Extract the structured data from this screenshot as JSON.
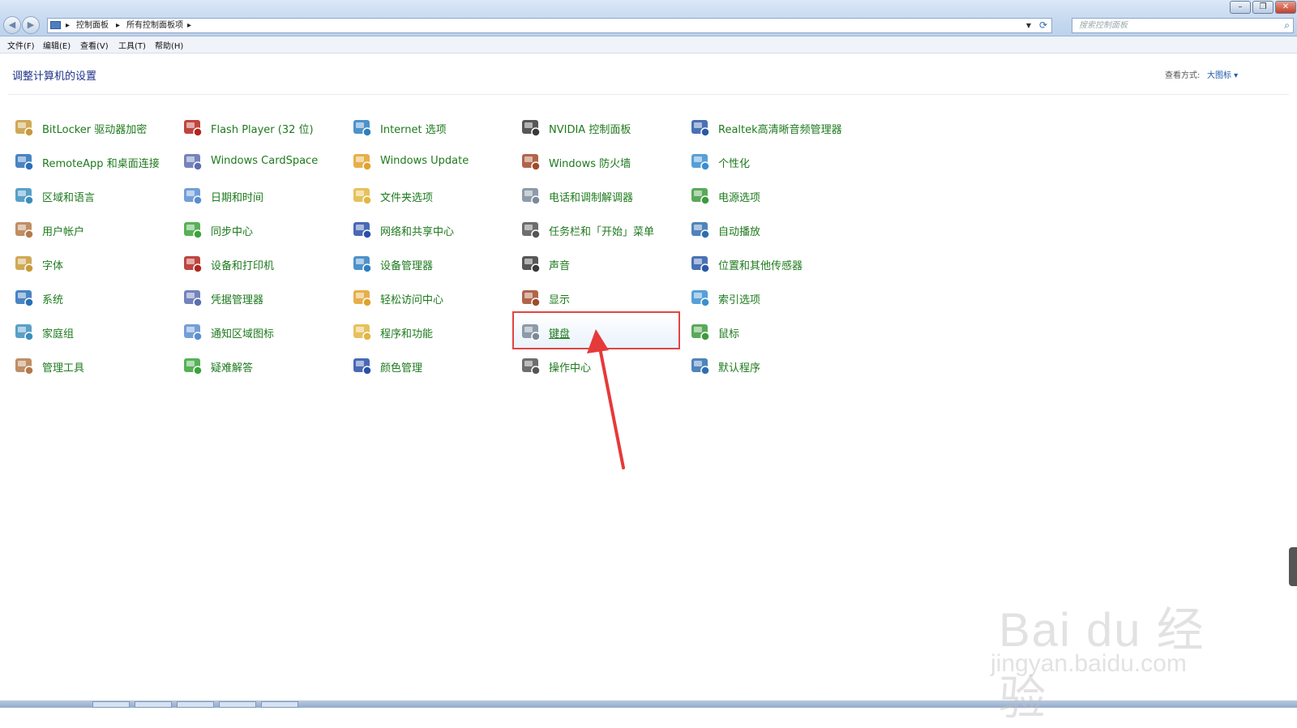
{
  "window": {
    "nav_back": "◀",
    "nav_forward": "▶",
    "breadcrumb": [
      "控制面板",
      "所有控制面板项"
    ],
    "crumb_separator": "▸",
    "search_placeholder": "搜索控制面板",
    "search_icon": "magnifier-icon",
    "refresh_icon": "refresh-icon",
    "controls": {
      "minimize": "–",
      "restore": "❐",
      "close": "✕"
    }
  },
  "menubar": [
    "文件(F)",
    "编辑(E)",
    "查看(V)",
    "工具(T)",
    "帮助(H)"
  ],
  "header": {
    "title": "调整计算机的设置",
    "view_by_label": "查看方式:",
    "view_by_value": "大图标 ▾"
  },
  "items": [
    {
      "label": "BitLocker 驱动器加密",
      "icon": "bitlocker-icon"
    },
    {
      "label": "Flash Player (32 位)",
      "icon": "flash-player-icon"
    },
    {
      "label": "Internet 选项",
      "icon": "internet-options-icon"
    },
    {
      "label": "NVIDIA 控制面板",
      "icon": "nvidia-icon"
    },
    {
      "label": "Realtek高清晰音频管理器",
      "icon": "realtek-audio-icon"
    },
    {
      "label": "RemoteApp 和桌面连接",
      "icon": "remoteapp-icon"
    },
    {
      "label": "Windows CardSpace",
      "icon": "cardspace-icon"
    },
    {
      "label": "Windows Update",
      "icon": "windows-update-icon"
    },
    {
      "label": "Windows 防火墙",
      "icon": "firewall-icon"
    },
    {
      "label": "个性化",
      "icon": "personalization-icon"
    },
    {
      "label": "区域和语言",
      "icon": "region-language-icon"
    },
    {
      "label": "日期和时间",
      "icon": "date-time-icon"
    },
    {
      "label": "文件夹选项",
      "icon": "folder-options-icon"
    },
    {
      "label": "电话和调制解调器",
      "icon": "phone-modem-icon"
    },
    {
      "label": "电源选项",
      "icon": "power-options-icon"
    },
    {
      "label": "用户帐户",
      "icon": "user-accounts-icon"
    },
    {
      "label": "同步中心",
      "icon": "sync-center-icon"
    },
    {
      "label": "网络和共享中心",
      "icon": "network-sharing-icon"
    },
    {
      "label": "任务栏和「开始」菜单",
      "icon": "taskbar-start-icon"
    },
    {
      "label": "自动播放",
      "icon": "autoplay-icon"
    },
    {
      "label": "字体",
      "icon": "fonts-icon"
    },
    {
      "label": "设备和打印机",
      "icon": "devices-printers-icon"
    },
    {
      "label": "设备管理器",
      "icon": "device-manager-icon"
    },
    {
      "label": "声音",
      "icon": "sound-icon"
    },
    {
      "label": "位置和其他传感器",
      "icon": "location-sensors-icon"
    },
    {
      "label": "系统",
      "icon": "system-icon"
    },
    {
      "label": "凭据管理器",
      "icon": "credential-manager-icon"
    },
    {
      "label": "轻松访问中心",
      "icon": "ease-of-access-icon"
    },
    {
      "label": "显示",
      "icon": "display-icon"
    },
    {
      "label": "索引选项",
      "icon": "indexing-options-icon"
    },
    {
      "label": "家庭组",
      "icon": "homegroup-icon"
    },
    {
      "label": "通知区域图标",
      "icon": "notification-area-icon"
    },
    {
      "label": "程序和功能",
      "icon": "programs-features-icon"
    },
    {
      "label": "键盘",
      "icon": "keyboard-icon",
      "selected": true
    },
    {
      "label": "鼠标",
      "icon": "mouse-icon"
    },
    {
      "label": "管理工具",
      "icon": "admin-tools-icon"
    },
    {
      "label": "疑难解答",
      "icon": "troubleshooting-icon"
    },
    {
      "label": "颜色管理",
      "icon": "color-management-icon"
    },
    {
      "label": "操作中心",
      "icon": "action-center-icon"
    },
    {
      "label": "默认程序",
      "icon": "default-programs-icon"
    }
  ],
  "annotation": {
    "arrow_color": "#e53a3a",
    "box_color": "#e24444"
  },
  "watermark": {
    "main": "Bai du 经验",
    "sub": "jingyan.baidu.com"
  },
  "colors": {
    "link_green": "#1e7a1e",
    "heading_blue": "#1e3287"
  }
}
